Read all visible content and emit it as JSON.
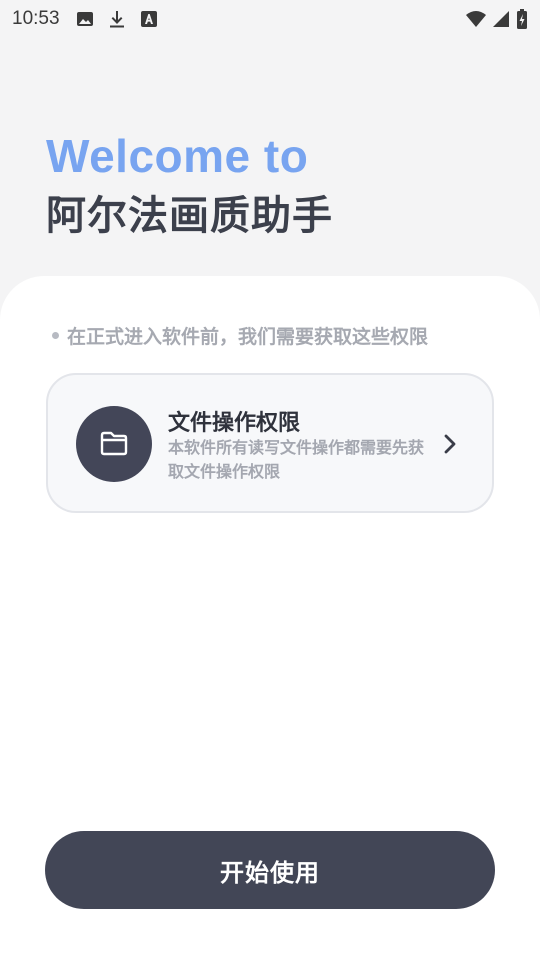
{
  "status_bar": {
    "time": "10:53",
    "left_icons": [
      "gallery-icon",
      "download-icon",
      "font-icon"
    ],
    "right_icons": [
      "wifi-icon",
      "cellular-signal-icon",
      "battery-icon"
    ]
  },
  "hero": {
    "welcome": "Welcome to",
    "app_name": "阿尔法画质助手"
  },
  "hint": "在正式进入软件前，我们需要获取这些权限",
  "permissions": [
    {
      "icon": "folder-icon",
      "title": "文件操作权限",
      "description": "本软件所有读写文件操作都需要先获取文件操作权限"
    }
  ],
  "start_button": "开始使用",
  "colors": {
    "accent": "#78a4f0",
    "dark": "#424656",
    "background": "#f4f4f5",
    "card": "#f7f8fa"
  }
}
